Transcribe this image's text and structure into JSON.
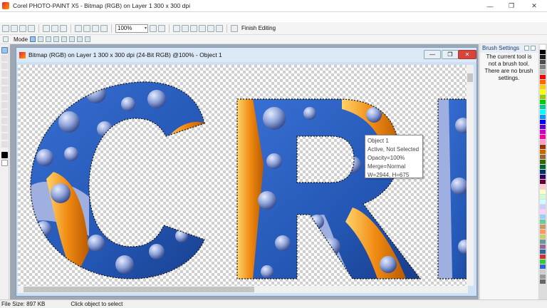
{
  "window": {
    "title": "Corel PHOTO-PAINT X5 - Bitmap (RGB) on Layer 1 300 x 300 dpi",
    "min_glyph": "—",
    "max_glyph": "❐",
    "close_glyph": "✕"
  },
  "toolbar": {
    "zoom_value": "100%",
    "zoom_dropdown_glyph": "▾",
    "finish_label": "Finish Editing"
  },
  "propbar": {
    "mode_label": "Mode"
  },
  "document": {
    "title": "Bitmap (RGB) on Layer 1 300 x 300 dpi (24-Bit RGB) @100% - Object 1",
    "min_glyph": "—",
    "max_glyph": "❐",
    "close_glyph": "✕"
  },
  "canvas": {
    "letters": [
      "C",
      "R",
      "I"
    ]
  },
  "tooltip": {
    "line1": "Object 1",
    "line2": "Active, Not Selected",
    "line3": "Opacity=100%",
    "line4": "Merge=Normal",
    "line5": "W=2944, H=675"
  },
  "brush_panel": {
    "title": "Brush Settings",
    "message": "The current tool is not a brush tool.  There are no brush settings."
  },
  "status": {
    "file_size": "File Size: 897 KB",
    "hint": "Click object to select"
  },
  "palette_colors": [
    "#ffffff",
    "#000000",
    "#1a1a1a",
    "#4d4d4d",
    "#808080",
    "#b3b3b3",
    "#ff0000",
    "#ff6600",
    "#ffcc00",
    "#ffff00",
    "#99cc00",
    "#00cc00",
    "#00cc99",
    "#00ffff",
    "#0099ff",
    "#0000ff",
    "#6600cc",
    "#cc00cc",
    "#ff0099",
    "#ff99cc",
    "#993300",
    "#cc6600",
    "#996633",
    "#336600",
    "#006633",
    "#003366",
    "#330066",
    "#660033",
    "#ffcccc",
    "#ffffcc",
    "#ccffcc",
    "#ccffff",
    "#ccccff",
    "#ffccff",
    "#99ccff",
    "#66cc99",
    "#cc9966",
    "#ff9966",
    "#cccc66",
    "#669999",
    "#996699",
    "#336699",
    "#cc3333",
    "#33cc33",
    "#3366cc",
    "#cccccc",
    "#999999",
    "#666666"
  ],
  "colors": {
    "blue_fill": "#2457b5",
    "orange_accent": "#f08a12",
    "bubble": "#8fa3d8",
    "selection_blue": "#4a7fb8",
    "close_red": "#d9443a"
  }
}
